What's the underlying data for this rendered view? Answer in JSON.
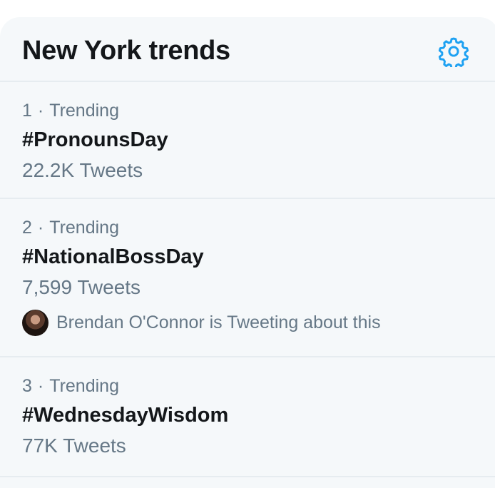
{
  "header": {
    "title": "New York trends",
    "settings_icon": "gear-icon",
    "accent_color": "#1da1f2"
  },
  "trends": [
    {
      "rank": "1",
      "separator": "·",
      "category": "Trending",
      "name": "#PronounsDay",
      "count": "22.2K Tweets"
    },
    {
      "rank": "2",
      "separator": "·",
      "category": "Trending",
      "name": "#NationalBossDay",
      "count": "7,599 Tweets",
      "context": "Brendan O'Connor is Tweeting about this",
      "context_icon": "avatar"
    },
    {
      "rank": "3",
      "separator": "·",
      "category": "Trending",
      "name": "#WednesdayWisdom",
      "count": "77K Tweets"
    }
  ],
  "colors": {
    "panel_background": "#f5f8fa",
    "primary_text": "#14171a",
    "secondary_text": "#657786",
    "divider": "#e6ecf0"
  }
}
